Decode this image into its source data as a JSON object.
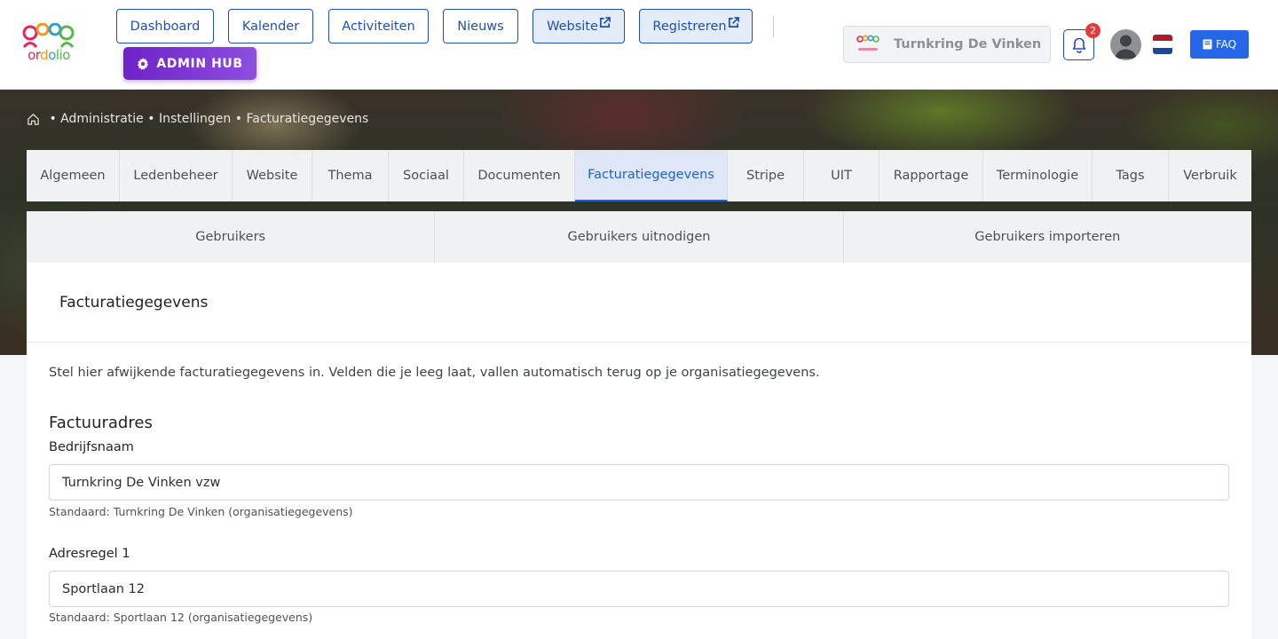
{
  "nav": {
    "buttons": [
      {
        "label": "Dashboard"
      },
      {
        "label": "Kalender"
      },
      {
        "label": "Activiteiten"
      },
      {
        "label": "Nieuws"
      },
      {
        "label": "Website"
      },
      {
        "label": "Registreren"
      }
    ],
    "admin_hub_label": "ADMIN HUB",
    "organization_name": "Turnkring De Vinken",
    "notification_count": "2",
    "faq_label": "FAQ",
    "logo_text": [
      "or",
      "d",
      "o",
      "lio"
    ],
    "accent_color": "#1d4fb8"
  },
  "breadcrumb": {
    "items": [
      "Administratie",
      "Instellingen",
      "Facturatiegegevens"
    ],
    "separator": " • "
  },
  "tabs": [
    {
      "label": "Algemeen"
    },
    {
      "label": "Ledenbeheer"
    },
    {
      "label": "Website"
    },
    {
      "label": "Thema"
    },
    {
      "label": "Sociaal"
    },
    {
      "label": "Documenten"
    },
    {
      "label": "Facturatiegegevens",
      "active": true
    },
    {
      "label": "Stripe"
    },
    {
      "label": "UIT"
    },
    {
      "label": "Rapportage"
    },
    {
      "label": "Terminologie"
    },
    {
      "label": "Tags"
    },
    {
      "label": "Verbruik"
    }
  ],
  "subtabs": [
    {
      "label": "Gebruikers"
    },
    {
      "label": "Gebruikers uitnodigen"
    },
    {
      "label": "Gebruikers importeren"
    }
  ],
  "card": {
    "title": "Facturatiegegevens",
    "intro": "Stel hier afwijkende facturatiegegevens in. Velden die je leeg laat, vallen automatisch terug op je organisatiegegevens.",
    "section_title": "Factuuradres",
    "fields": [
      {
        "label": "Bedrijfsnaam",
        "value": "Turnkring De Vinken vzw",
        "help": "Standaard: Turnkring De Vinken (organisatiegegevens)"
      },
      {
        "label": "Adresregel 1",
        "value": "Sportlaan 12",
        "help": "Standaard: Sportlaan 12 (organisatiegegevens)"
      }
    ]
  }
}
